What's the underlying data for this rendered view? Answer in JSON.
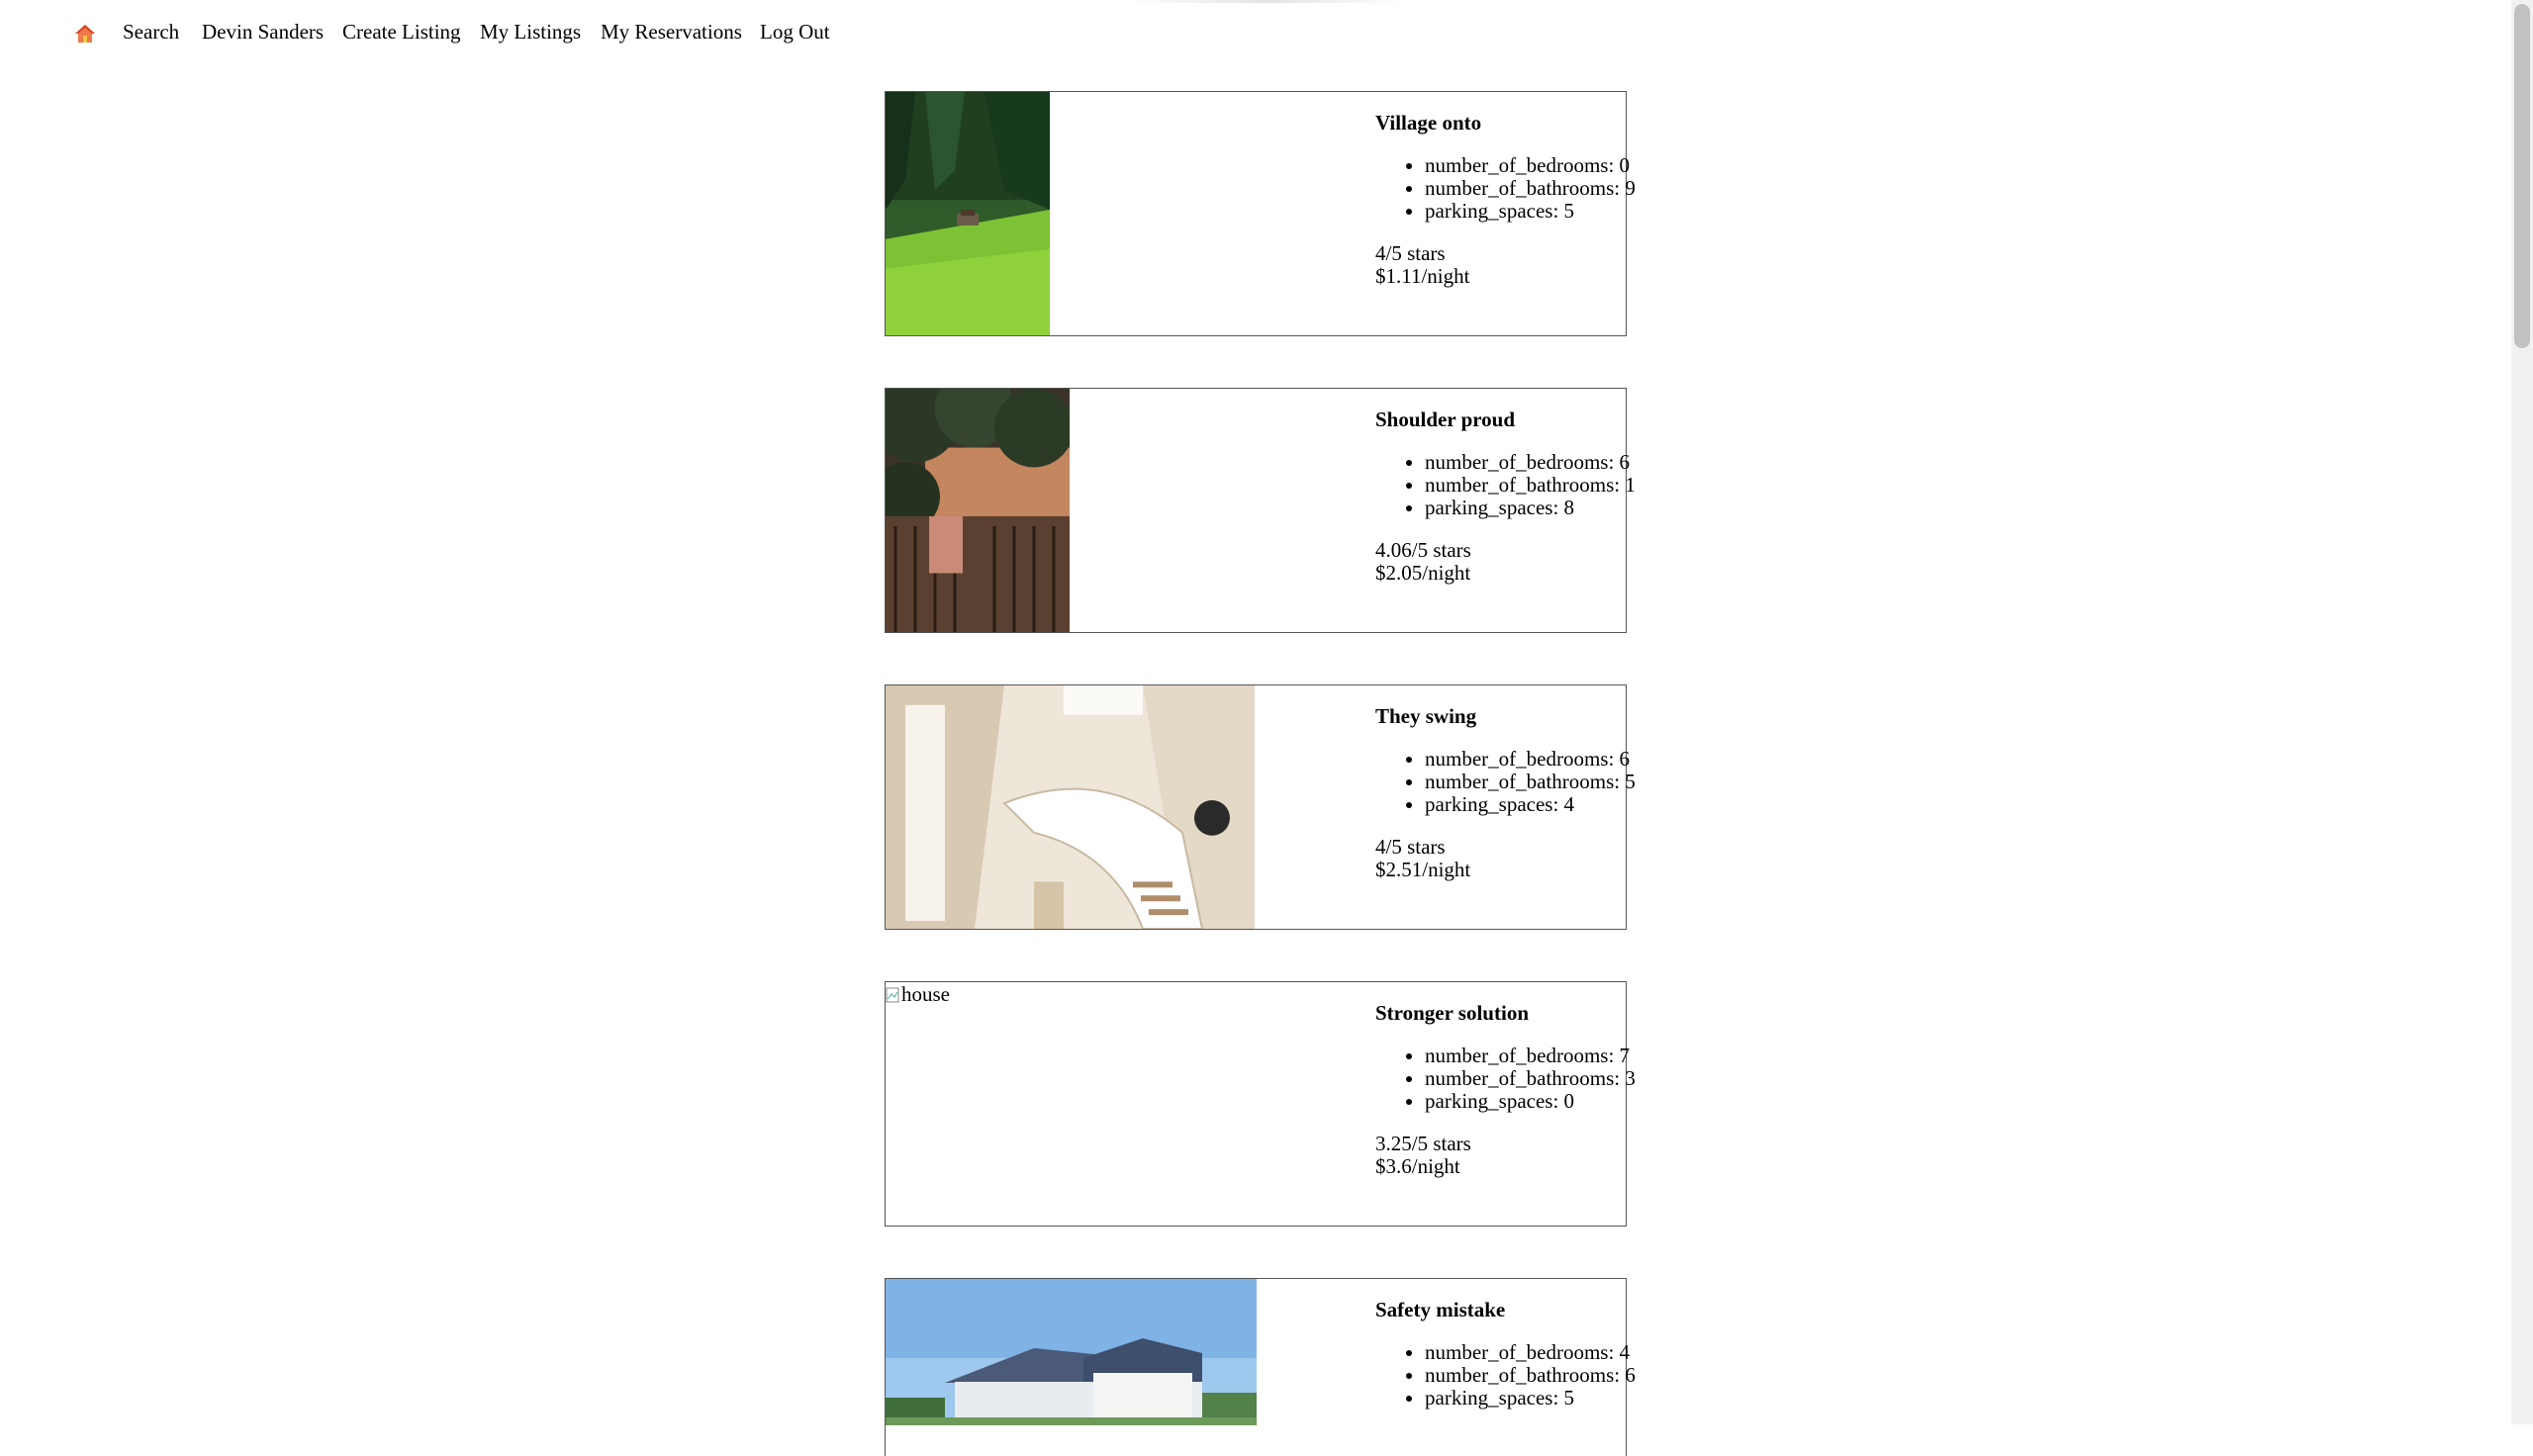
{
  "nav": {
    "home_icon": "home-icon",
    "links": [
      "Search",
      "Devin Sanders",
      "Create Listing",
      "My Listings",
      "My Reservations",
      "Log Out"
    ]
  },
  "listings": [
    {
      "title": "Village onto",
      "bedrooms": "number_of_bedrooms: 0",
      "bathrooms": "number_of_bathrooms: 9",
      "parking": "parking_spaces: 5",
      "rating": "4/5 stars",
      "price": "$1.11/night",
      "image_alt": "house"
    },
    {
      "title": "Shoulder proud",
      "bedrooms": "number_of_bedrooms: 6",
      "bathrooms": "number_of_bathrooms: 1",
      "parking": "parking_spaces: 8",
      "rating": "4.06/5 stars",
      "price": "$2.05/night",
      "image_alt": "house"
    },
    {
      "title": "They swing",
      "bedrooms": "number_of_bedrooms: 6",
      "bathrooms": "number_of_bathrooms: 5",
      "parking": "parking_spaces: 4",
      "rating": "4/5 stars",
      "price": "$2.51/night",
      "image_alt": "house"
    },
    {
      "title": "Stronger solution",
      "bedrooms": "number_of_bedrooms: 7",
      "bathrooms": "number_of_bathrooms: 3",
      "parking": "parking_spaces: 0",
      "rating": "3.25/5 stars",
      "price": "$3.6/night",
      "image_alt": "house"
    },
    {
      "title": "Safety mistake",
      "bedrooms": "number_of_bedrooms: 4",
      "bathrooms": "number_of_bathrooms: 6",
      "parking": "parking_spaces: 5",
      "rating": "",
      "price": "",
      "image_alt": "house"
    }
  ]
}
